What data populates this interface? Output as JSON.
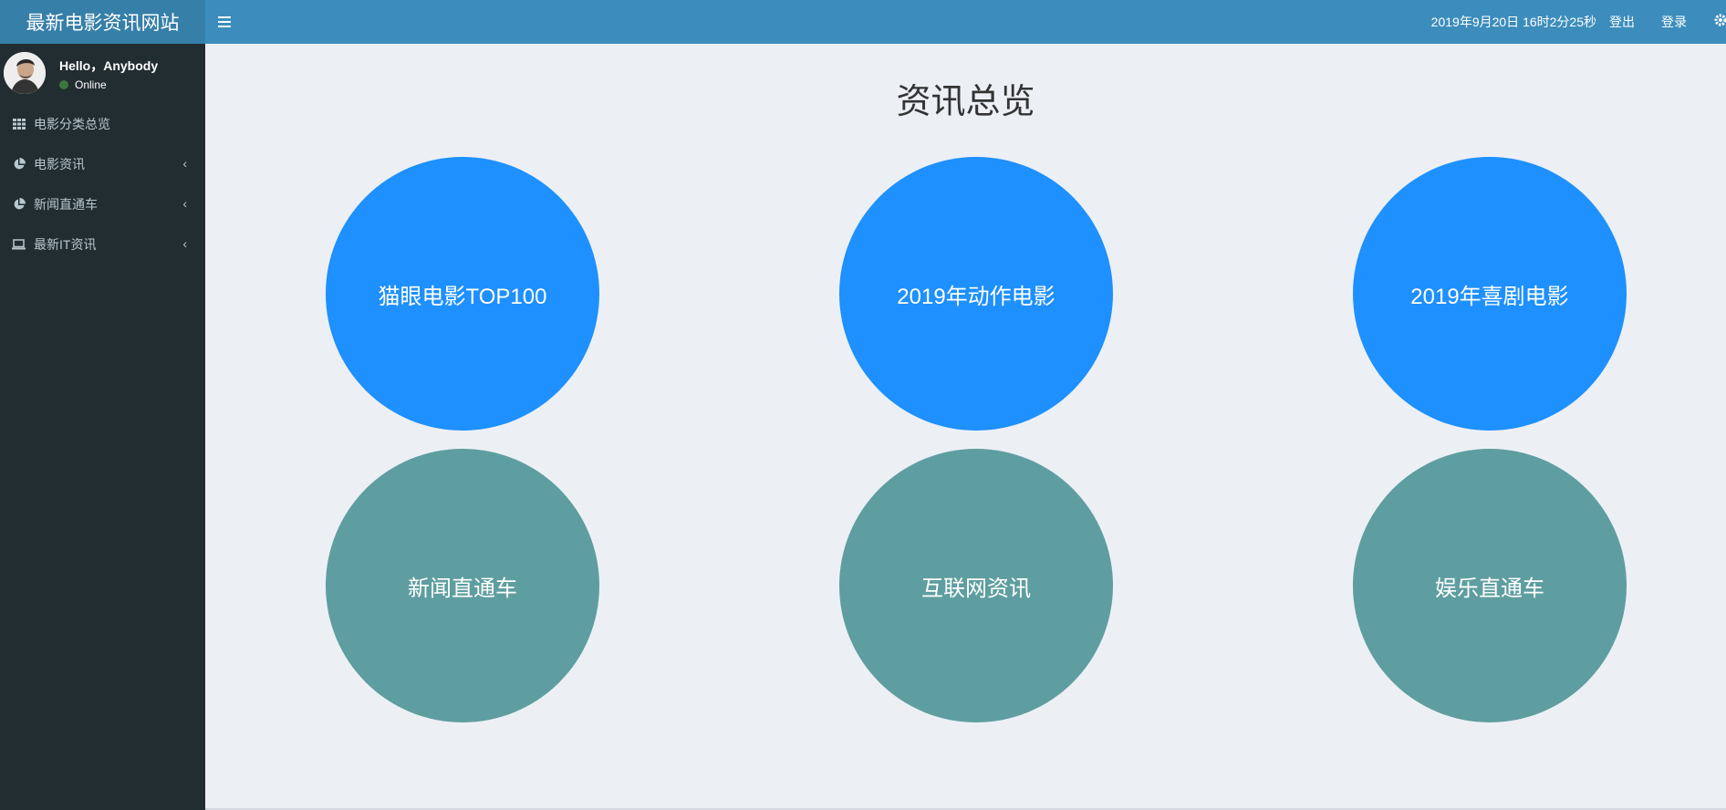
{
  "header": {
    "logo": "最新电影资讯网站",
    "menu_toggle_icon": "hamburger-icon",
    "datetime": "2019年9月20日 16时2分25秒",
    "logout": "登出",
    "login": "登录",
    "settings_icon": "gear-icon"
  },
  "user": {
    "greeting": "Hello，Anybody",
    "status": "Online",
    "status_color": "#3c763d"
  },
  "sidebar": {
    "items": [
      {
        "label": "电影分类总览",
        "icon": "grid-icon"
      },
      {
        "label": "电影资讯",
        "icon": "pie-chart-icon"
      },
      {
        "label": "新闻直通车",
        "icon": "pie-chart-icon"
      },
      {
        "label": "最新IT资讯",
        "icon": "laptop-icon"
      }
    ]
  },
  "main": {
    "title": "资讯总览",
    "tiles": [
      {
        "label": "猫眼电影TOP100",
        "color": "#1e90ff"
      },
      {
        "label": "2019年动作电影",
        "color": "#1e90ff"
      },
      {
        "label": "2019年喜剧电影",
        "color": "#1e90ff"
      },
      {
        "label": "新闻直通车",
        "color": "#5f9ea0"
      },
      {
        "label": "互联网资讯",
        "color": "#5f9ea0"
      },
      {
        "label": "娱乐直通车",
        "color": "#5f9ea0"
      }
    ]
  },
  "colors": {
    "header": "#3c8dbc",
    "logo_bg": "#367fa9",
    "sidebar": "#222d32",
    "content_bg": "#ecf0f5"
  }
}
